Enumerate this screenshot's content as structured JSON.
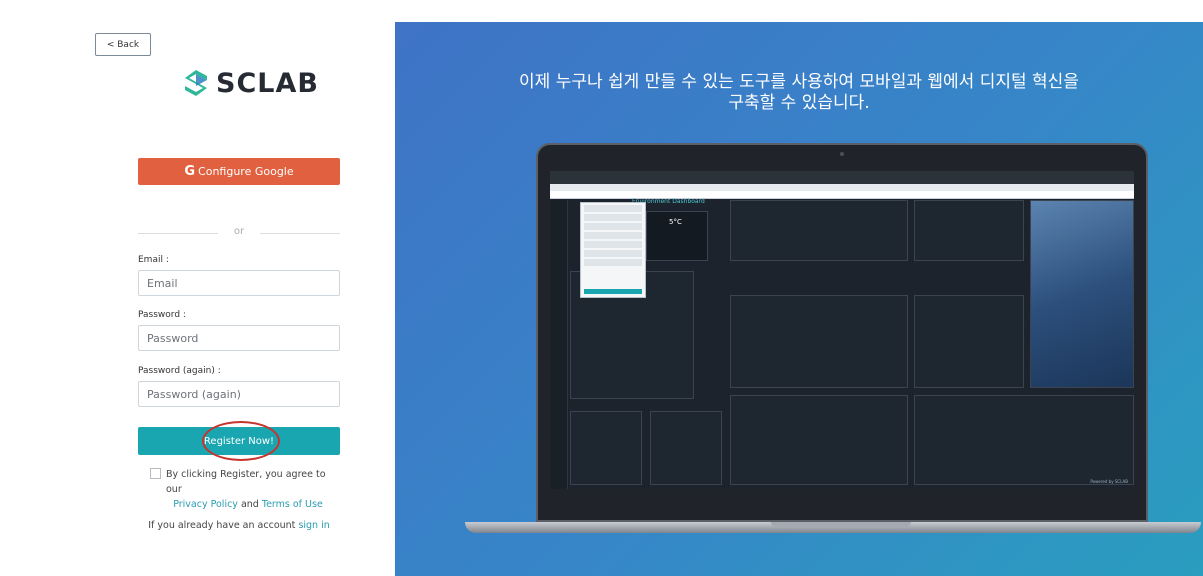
{
  "nav": {
    "back_label": "< Back"
  },
  "brand": {
    "name": "SCLAB",
    "logo_colors": [
      "#2fb79a",
      "#2e7fbf"
    ]
  },
  "auth": {
    "google_label": "Configure Google",
    "google_icon": "G",
    "or_label": "or",
    "email": {
      "label": "Email :",
      "placeholder": "Email"
    },
    "password": {
      "label": "Password :",
      "placeholder": "Password"
    },
    "password_again": {
      "label": "Password (again) :",
      "placeholder": "Password (again)"
    },
    "register_label": "Register Now!",
    "agree_prefix": "By clicking Register, you agree to our",
    "privacy_label": "Privacy Policy",
    "and_label": "and",
    "terms_label": "Terms of Use",
    "signin_prefix": "If you already have an account",
    "signin_label": "sign in"
  },
  "hero": {
    "title_line1": "이제 누구나 쉽게 만들 수 있는 도구를 사용하여 모바일과 웹에서 디지털 혁신을",
    "title_line2": "구축할 수 있습니다."
  },
  "preview": {
    "dashboard_title": "Environment Dashboard",
    "temperature": "5°C",
    "powered_by": "Powered by SCLAB",
    "colors": {
      "accent": "#1aa6b1",
      "google": "#e0603f",
      "hero_start": "#3f73c6",
      "hero_end": "#2a9ebf"
    }
  }
}
